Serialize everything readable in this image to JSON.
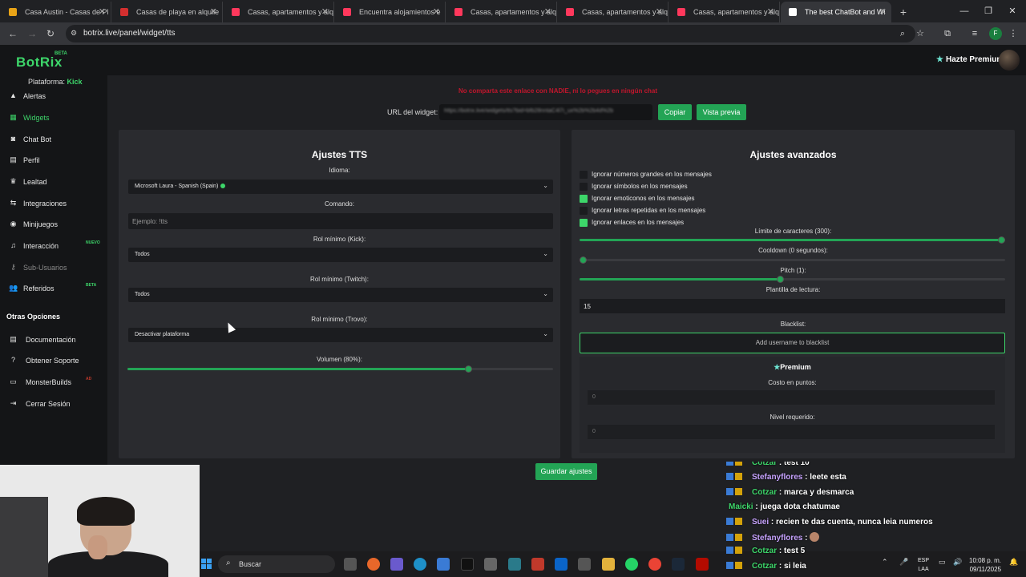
{
  "browser": {
    "tabs": [
      {
        "title": "Casa Austin - Casas de Pl",
        "favicon_color": "#e8a317"
      },
      {
        "title": "Casas de playa en alquile",
        "favicon_color": "#d32f2f"
      },
      {
        "title": "Casas, apartamentos y alq",
        "favicon_color": "#ff385c"
      },
      {
        "title": "Encuentra alojamientos e",
        "favicon_color": "#ff385c"
      },
      {
        "title": "Casas, apartamentos y alq",
        "favicon_color": "#ff385c"
      },
      {
        "title": "Casas, apartamentos y alq",
        "favicon_color": "#ff385c"
      },
      {
        "title": "Casas, apartamentos y alq",
        "favicon_color": "#ff385c"
      },
      {
        "title": "The best ChatBot and Wi",
        "favicon_color": "#ffffff"
      }
    ],
    "url": "botrix.live/panel/widget/tts",
    "profile_letter": "F"
  },
  "app": {
    "logo": "BotRix",
    "logo_badge": "BETA",
    "premium_cta": "Hazte Premium",
    "platform_label": "Plataforma:",
    "platform_value": "Kick",
    "accent": "#23a455"
  },
  "sidebar": {
    "items": [
      {
        "label": "Alertas",
        "icon": "alert-icon"
      },
      {
        "label": "Widgets",
        "icon": "widgets-icon"
      },
      {
        "label": "Chat Bot",
        "icon": "robot-icon"
      },
      {
        "label": "Perfil",
        "icon": "profile-card-icon"
      },
      {
        "label": "Lealtad",
        "icon": "trophy-icon"
      },
      {
        "label": "Integraciones",
        "icon": "link-icon"
      },
      {
        "label": "Minijuegos",
        "icon": "gamepad-icon"
      },
      {
        "label": "Interacción",
        "icon": "music-icon",
        "badge": "NUEVO"
      },
      {
        "label": "Sub-Usuarios",
        "icon": "key-icon"
      },
      {
        "label": "Referidos",
        "icon": "users-icon",
        "badge": "BETA"
      }
    ],
    "other_title": "Otras Opciones",
    "other_items": [
      {
        "label": "Documentación",
        "icon": "document-icon"
      },
      {
        "label": "Obtener Soporte",
        "icon": "help-icon"
      },
      {
        "label": "MonsterBuilds",
        "icon": "monitor-icon",
        "badge": "AD"
      },
      {
        "label": "Cerrar Sesión",
        "icon": "logout-icon"
      }
    ]
  },
  "widget": {
    "warning": "No comparta este enlace con NADIE, ni lo pegues en ningún chat",
    "url_label": "URL del widget:",
    "url_value": "https://botrix.live/widgets/tts?bid=bfb28nntaC4l7i_ux%2b%2b4d%2b",
    "copy_label": "Copiar",
    "preview_label": "Vista previa"
  },
  "tts": {
    "title": "Ajustes TTS",
    "idioma_label": "Idioma:",
    "idioma_value": "Microsoft Laura - Spanish (Spain)",
    "comando_label": "Comando:",
    "comando_placeholder": "Ejemplo: !tts",
    "rol_kick_label": "Rol mínimo (Kick):",
    "rol_kick_value": "Todos",
    "rol_twitch_label": "Rol mínimo (Twitch):",
    "rol_twitch_value": "Todos",
    "rol_trovo_label": "Rol mínimo (Trovo):",
    "rol_trovo_value": "Desactivar plataforma",
    "volumen_label": "Volumen (80%):",
    "volumen_value": 0.8
  },
  "advanced": {
    "title": "Ajustes avanzados",
    "checkboxes": [
      {
        "label": "Ignorar números grandes en los mensajes",
        "checked": false
      },
      {
        "label": "Ignorar símbolos en los mensajes",
        "checked": false
      },
      {
        "label": "Ignorar emoticonos en los mensajes",
        "checked": true
      },
      {
        "label": "Ignorar letras repetidas en los mensajes",
        "checked": false
      },
      {
        "label": "Ignorar enlaces en los mensajes",
        "checked": true
      }
    ],
    "limite_label": "Límite de caracteres (300):",
    "limite_value": 1.0,
    "cooldown_label": "Cooldown (0 segundos):",
    "cooldown_value": 0.0,
    "pitch_label": "Pitch (1):",
    "pitch_value": 0.47,
    "plantilla_label": "Plantilla de lectura:",
    "plantilla_value": "15",
    "blacklist_label": "Blacklist:",
    "blacklist_placeholder": "Add username to blacklist",
    "premium_title": "Premium",
    "costo_label": "Costo en puntos:",
    "costo_value": "0",
    "nivel_label": "Nivel requerido:",
    "nivel_value": "0"
  },
  "save_label": "Guardar ajustes",
  "chat": [
    {
      "user": "Cotzar",
      "msg": "test 10",
      "color": "green",
      "badges": true
    },
    {
      "user": "Stefanyflores",
      "msg": "leete esta",
      "color": "purple",
      "badges": true
    },
    {
      "user": "Cotzar",
      "msg": "marca y desmarca",
      "color": "green",
      "badges": true
    },
    {
      "user": "Maicki",
      "msg": "juega dota chatumae",
      "color": "green",
      "badges": false
    },
    {
      "user": "Suei",
      "msg": "recien te das cuenta, nunca leia numeros",
      "color": "purple",
      "badges": true
    },
    {
      "user": "Stefanyflores",
      "msg": "",
      "color": "purple",
      "badges": true,
      "emoji": true
    },
    {
      "user": "Cotzar",
      "msg": "test 5",
      "color": "green",
      "badges": true
    },
    {
      "user": "Cotzar",
      "msg": "si leia",
      "color": "green",
      "badges": true
    }
  ],
  "taskbar": {
    "search_label": "Buscar",
    "lang_line1": "ESP",
    "lang_line2": "LAA",
    "time": "10:08 p. m.",
    "date": "09/11/2025"
  }
}
